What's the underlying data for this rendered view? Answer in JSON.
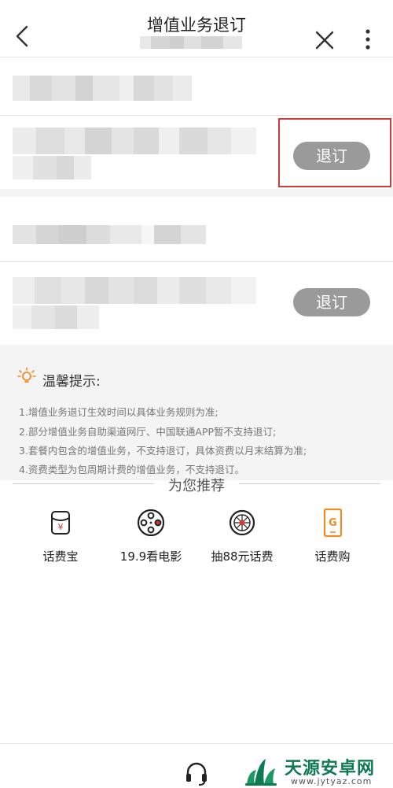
{
  "header": {
    "title": "增值业务退订",
    "back_icon": "chevron-left-icon",
    "close_icon": "close-icon",
    "more_icon": "more-vertical-icon"
  },
  "services": [
    {
      "action_label": "退订"
    },
    {
      "action_label": "退订"
    }
  ],
  "tips": {
    "heading": "温馨提示:",
    "icon": "lightbulb-icon",
    "lines": [
      "1.增值业务退订生效时间以具体业务规则为准;",
      "2.部分增值业务自助渠道网厅、中国联通APP暂不支持退订;",
      "3.套餐内包含的增值业务，不支持退订，具体资费以月末结算为准;",
      "4.资费类型为包周期计费的增值业务，不支持退订。"
    ]
  },
  "recommend": {
    "title": "为您推荐",
    "items": [
      {
        "label": "话费宝",
        "icon": "red-envelope-icon"
      },
      {
        "label": "19.9看电影",
        "icon": "film-reel-icon"
      },
      {
        "label": "抽88元话费",
        "icon": "prize-wheel-icon"
      },
      {
        "label": "话费购",
        "icon": "phone-shop-icon"
      }
    ]
  },
  "bottom_bar": {
    "icon": "headset-icon"
  },
  "watermark": {
    "text": "天源安卓网",
    "url": "www.jytyaz.com"
  },
  "colors": {
    "button_gray": "#9a9a9a",
    "highlight_red": "#d43a3a",
    "accent_orange": "#f08a24",
    "tips_bg": "#f4f4f4",
    "watermark_green": "#0f7a52"
  }
}
